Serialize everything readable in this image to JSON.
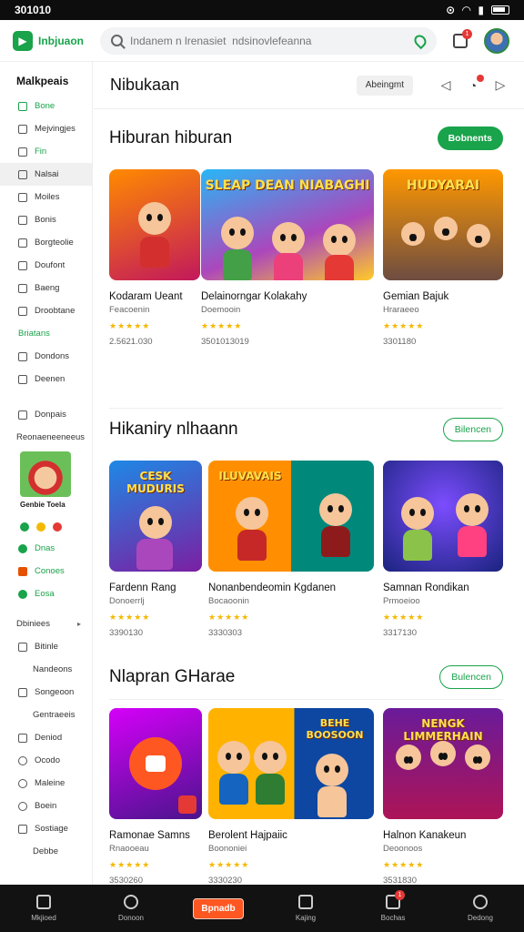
{
  "status": {
    "time": "301010"
  },
  "header": {
    "logo_text": "Inbjuaon",
    "search_placeholder": "Indanem n lrenasiet  ndsinovlefeanna",
    "bell_badge": "1"
  },
  "sidebar": {
    "title": "Malkpeais",
    "items": [
      {
        "label": "Bone",
        "icon": "home-icon"
      },
      {
        "label": "Mejvingjes",
        "icon": "grid-icon"
      },
      {
        "label": "Fin",
        "icon": "fire-icon"
      },
      {
        "label": "Nalsai",
        "icon": "square-icon"
      },
      {
        "label": "Moiles",
        "icon": "film-icon"
      },
      {
        "label": "Bonis",
        "icon": "book-icon"
      },
      {
        "label": "Borgteolie",
        "icon": "play-icon"
      },
      {
        "label": "Doufont",
        "icon": "doc-icon"
      },
      {
        "label": "Baeng",
        "icon": "chat-icon"
      },
      {
        "label": "Droobtane",
        "icon": "camera-icon"
      }
    ],
    "group_label": "Briatans",
    "group_items": [
      {
        "label": "Dondons",
        "icon": "puzzle-icon"
      },
      {
        "label": "Deenen",
        "icon": "tablet-icon"
      }
    ],
    "section2_item": "Donpais",
    "section2_label": "Reonaeneeneeus",
    "promo_caption": "Genbie Toela",
    "extra_items": [
      {
        "label": "Dnas",
        "icon": "heart-icon"
      },
      {
        "label": "Conoes",
        "icon": "bag-icon"
      },
      {
        "label": "Eosa",
        "icon": "check-icon"
      }
    ],
    "bottom_group": "Dbiniees",
    "bottom_items": [
      {
        "label": "Bitinle",
        "icon": "globe-icon"
      },
      {
        "label": "Nandeons",
        "icon": ""
      },
      {
        "label": "Songeoon",
        "icon": "box-icon"
      },
      {
        "label": "Gentraeeis",
        "icon": ""
      },
      {
        "label": "Deniod",
        "icon": "calendar-icon"
      },
      {
        "label": "Ocodo",
        "icon": "circle-icon"
      },
      {
        "label": "Maleine",
        "icon": "phone-icon"
      },
      {
        "label": "Boein",
        "icon": "clock-icon"
      },
      {
        "label": "Sostiage",
        "icon": "tag-icon"
      },
      {
        "label": "Debbe",
        "icon": ""
      }
    ]
  },
  "main": {
    "title": "Nibukaan",
    "header_button": "Abeingmt",
    "sections": [
      {
        "title": "Hiburan hiburan",
        "button": "Bobnents",
        "cards": [
          {
            "title": "Kodaram Ueant",
            "sub": "Feacoenin",
            "rating": "★★★★★",
            "meta": "2.5621.030"
          },
          {
            "title": "Delainorngar Kolakahy",
            "sub": "Doemooin",
            "rating": "★★★★★",
            "meta": "3501013019"
          },
          {
            "title": "Gemian Bajuk",
            "sub": "Hraraeeo",
            "rating": "★★★★★",
            "meta": "3301180"
          }
        ],
        "thumb_texts": [
          "",
          "SLEAP DEAN NIABAGHI",
          "HUDYARAI"
        ]
      },
      {
        "title": "Hikaniry nlhaann",
        "button": "Bilencen",
        "cards": [
          {
            "title": "Fardenn Rang",
            "sub": "Donoerrlj",
            "rating": "★★★★★",
            "meta": "3390130"
          },
          {
            "title": "Nonanbendeomin Kgdanen",
            "sub": "Bocaoonin",
            "rating": "★★★★★",
            "meta": "3330303"
          },
          {
            "title": "Samnan Rondikan",
            "sub": "Prmoeioo",
            "rating": "★★★★★",
            "meta": "3317130"
          }
        ],
        "thumb_texts": [
          "CESK MUDURIS",
          "ILUVAVAIS",
          ""
        ]
      },
      {
        "title": "Nlapran GHarae",
        "button": "Bulencen",
        "cards": [
          {
            "title": "Ramonae Samns",
            "sub": "Rnaooeau",
            "rating": "★★★★★",
            "meta": "3530260"
          },
          {
            "title": "Berolent Hajpaiic",
            "sub": "Boononiei",
            "rating": "★★★★★",
            "meta": "3330230"
          },
          {
            "title": "Halnon Kanakeun",
            "sub": "Deoonoos",
            "rating": "★★★★★",
            "meta": "3531830"
          }
        ],
        "thumb_texts": [
          "",
          "BEHE BOOSOON",
          "NENGK LIMMERHAIN"
        ]
      }
    ]
  },
  "bottom_nav": [
    {
      "label": "Mkjioed",
      "icon": "home-icon"
    },
    {
      "label": "Donoon",
      "icon": "compass-icon"
    },
    {
      "label": "Bpnadb",
      "icon": "center-button"
    },
    {
      "label": "Kajing",
      "icon": "gamepad-icon"
    },
    {
      "label": "Bochas",
      "icon": "grid-icon",
      "badge": "1"
    },
    {
      "label": "Dedong",
      "icon": "user-icon"
    }
  ]
}
